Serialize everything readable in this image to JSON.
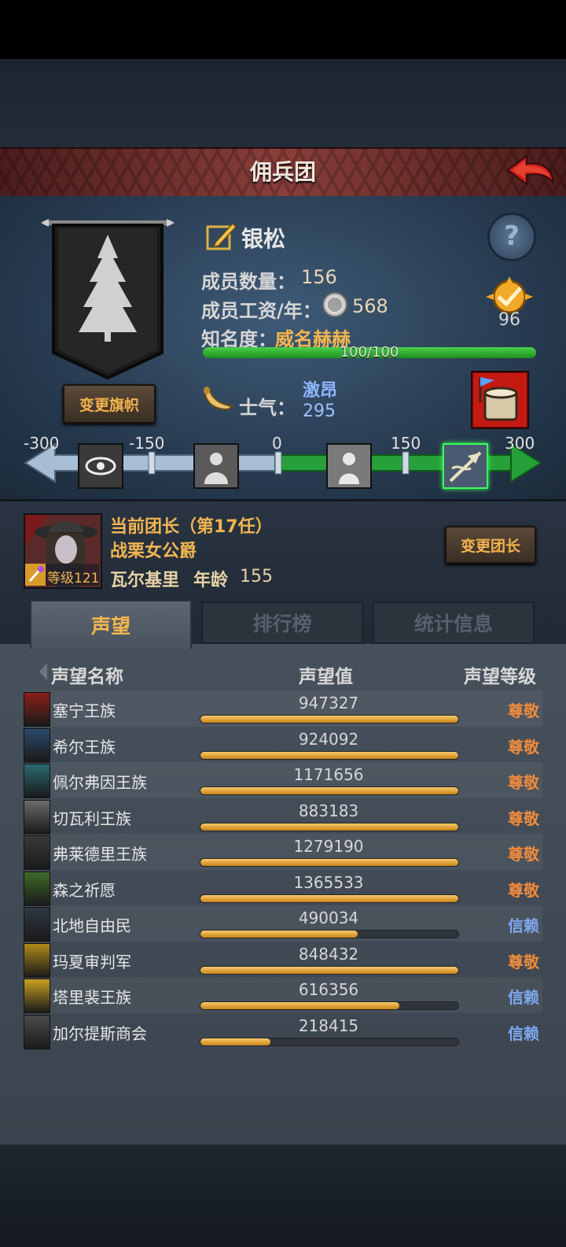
{
  "header": {
    "title": "佣兵团"
  },
  "corp": {
    "name": "银松",
    "members_label": "成员数量：",
    "members_value": "156",
    "wage_label": "成员工资/年：",
    "wage_value": "568",
    "fame_label": "知名度：",
    "fame_value": "威名赫赫",
    "fame_progress_text": "100/100",
    "fame_progress": 1.0,
    "badge_value": "96",
    "change_flag_label": "变更旗帜",
    "help_label": "?"
  },
  "morale": {
    "label": "士气：",
    "state": "激昂",
    "value": "295",
    "ticks": [
      "-300",
      "-150",
      "0",
      "150",
      "300"
    ]
  },
  "leader": {
    "heading": "当前团长（第17任）",
    "title": "战栗女公爵",
    "name": "瓦尔基里",
    "age_label": "年龄",
    "age": "155",
    "level_text": "等级121",
    "change_label": "变更团长"
  },
  "tabs": [
    "声望",
    "排行榜",
    "统计信息"
  ],
  "table": {
    "headers": [
      "声望名称",
      "声望值",
      "声望等级"
    ],
    "rows": [
      {
        "name": "塞宁王族",
        "value": "947327",
        "level": "尊敬",
        "progress": 1.0,
        "color": "#8a1f1a"
      },
      {
        "name": "希尔王族",
        "value": "924092",
        "level": "尊敬",
        "progress": 1.0,
        "color": "#2a4a6a"
      },
      {
        "name": "佩尔弗因王族",
        "value": "1171656",
        "level": "尊敬",
        "progress": 1.0,
        "color": "#2a6a70"
      },
      {
        "name": "切瓦利王族",
        "value": "883183",
        "level": "尊敬",
        "progress": 1.0,
        "color": "#6a6a6a"
      },
      {
        "name": "弗莱德里王族",
        "value": "1279190",
        "level": "尊敬",
        "progress": 1.0,
        "color": "#3a3a3a"
      },
      {
        "name": "森之祈愿",
        "value": "1365533",
        "level": "尊敬",
        "progress": 1.0,
        "color": "#3f6a2a"
      },
      {
        "name": "北地自由民",
        "value": "490034",
        "level": "信赖",
        "progress": 0.61,
        "color": "#2f3844"
      },
      {
        "name": "玛夏审判军",
        "value": "848432",
        "level": "尊敬",
        "progress": 1.0,
        "color": "#b08a1a"
      },
      {
        "name": "塔里裴王族",
        "value": "616356",
        "level": "信赖",
        "progress": 0.77,
        "color": "#c8a020"
      },
      {
        "name": "加尔提斯商会",
        "value": "218415",
        "level": "信赖",
        "progress": 0.27,
        "color": "#4a4a4a"
      }
    ]
  },
  "colors": {
    "respect": "#f08a3c",
    "trust": "#7fa8f0"
  }
}
